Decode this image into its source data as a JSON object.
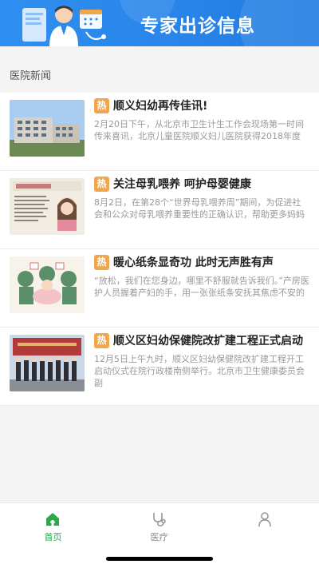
{
  "banner": {
    "title": "专家出诊信息"
  },
  "section": {
    "label": "医院新闻"
  },
  "news": [
    {
      "badge": "热",
      "title": "顺义妇幼再传佳讯!",
      "summary": "2月20日下午，从北京市卫生计生工作会现场第一时间传来喜讯，北京儿童医院顺义妇儿医院获得2018年度"
    },
    {
      "badge": "热",
      "title": "关注母乳喂养 呵护母婴健康",
      "summary": "8月2日，在第28个“世界母乳喂养周”期间，为促进社会和公众对母乳喂养重要性的正确认识，帮助更多妈妈"
    },
    {
      "badge": "热",
      "title": "暖心纸条显奇功 此时无声胜有声",
      "summary": "“放松，我们在您身边，哪里不舒服就告诉我们。”产房医护人员握着产妇的手，用一张张纸条安抚其焦虑不安的"
    },
    {
      "badge": "热",
      "title": "顺义区妇幼保健院改扩建工程正式启动",
      "summary": "12月5日上午九时，顺义区妇幼保健院改扩建工程开工启动仪式在院行政楼南侧举行。北京市卫生健康委员会副"
    }
  ],
  "tabs": [
    {
      "label": "首页",
      "icon": "home-icon",
      "active": true
    },
    {
      "label": "医疗",
      "icon": "stethoscope-icon",
      "active": false
    },
    {
      "label": "",
      "icon": "user-icon",
      "active": false
    }
  ],
  "colors": {
    "banner": "#2a86ea",
    "hot_badge": "#f2a54a",
    "tab_active": "#2aa84a"
  }
}
